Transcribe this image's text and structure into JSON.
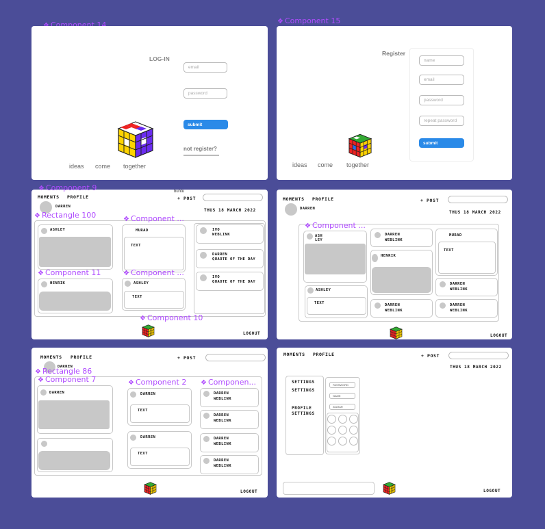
{
  "labels": {
    "comp14": "Component 14",
    "comp15": "Component 15",
    "comp9": "Component 9",
    "rect100": "Rectangle 100",
    "comp_dots_a": "Component ...",
    "comp11": "Component 11",
    "comp_dots_b": "Component ...",
    "comp10": "Component 10",
    "comp_dots_c": "Component ...",
    "rect86": "Rectangle 86",
    "comp7": "Component 7",
    "comp2": "Component 2",
    "compon": "Componen..."
  },
  "login": {
    "title": "LOG-IN",
    "email_ph": "email",
    "password_ph": "password",
    "submit": "submit",
    "not_register": "not register?",
    "words": [
      "ideas",
      "come",
      "together"
    ]
  },
  "register": {
    "title": "Register",
    "name_ph": "name",
    "email_ph": "email",
    "password_ph": "password",
    "repeat_ph": "repeat password",
    "submit": "submit",
    "words": [
      "ideas",
      "come",
      "together"
    ]
  },
  "nav": {
    "moments": "MOMENTS",
    "profile": "PROFILE",
    "post": "+ POST",
    "user": "DARREN",
    "date": "THUS 18 MARCH 2022",
    "logout": "LOGOUT",
    "buntu": "buntu"
  },
  "feed1": {
    "ashley": "ASHLEY",
    "henrik": "HENRIK",
    "murad": "MURAD",
    "text": "TEXT",
    "ashley2": "ASHLEY",
    "right": [
      {
        "l1": "IVO",
        "l2": "WEBLINK"
      },
      {
        "l1": "DARREN",
        "l2": "QUAOTE OF THE DAY"
      },
      {
        "l1": "IVO",
        "l2": "QUAOTE OF THE DAY"
      }
    ]
  },
  "feed2": {
    "ashley": "ASH\nLEY",
    "ash1": "ASH",
    "ash2": "LEY",
    "ashley2": "ASHLEY",
    "text": "TEXT",
    "darren": "DARREN",
    "weblink": "WEBLINK",
    "henrik": "HENRIK",
    "murad": "MURAD"
  },
  "feed3": {
    "darren": "DARREN",
    "text": "TEXT",
    "weblink": "WEBLINK"
  },
  "settings": {
    "s1": "SETTINGS",
    "s2": "SETTINGS",
    "p1": "PROFILE",
    "p2": "SETTINGS",
    "f1": "PASSWORD",
    "f2": "NAME",
    "f3": "AVATAR"
  }
}
